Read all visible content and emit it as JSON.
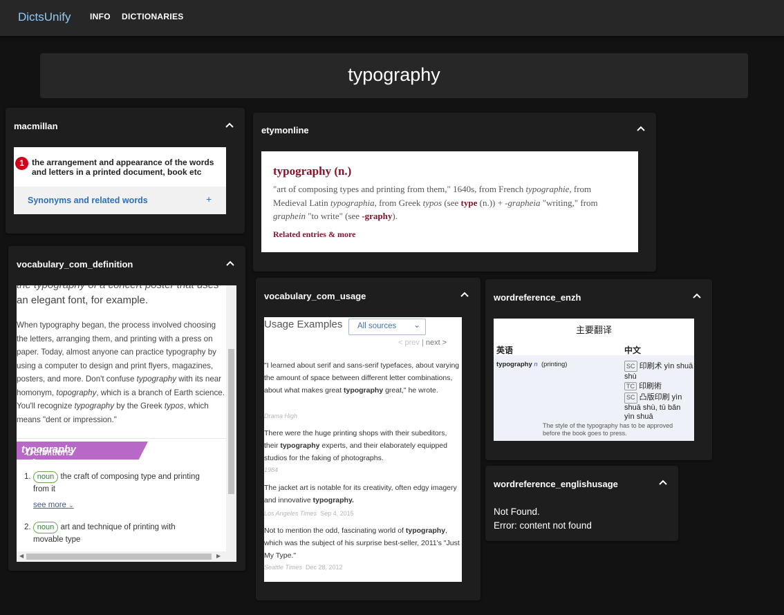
{
  "app": {
    "brand": "DictsUnify",
    "nav": [
      "INFO",
      "DICTIONARIES"
    ]
  },
  "search": {
    "query": "typography"
  },
  "cards": {
    "macmillan": {
      "title": "macmillan",
      "sense_number": "1",
      "definition": "the arrangement and appearance of the words and letters in a printed document, book etc",
      "synonyms_label": "Synonyms and related words",
      "synonyms_icon": "+"
    },
    "etymonline": {
      "title": "etymonline",
      "headword": "typography (n.)",
      "related": "Related entries & more"
    },
    "vocab_def": {
      "title": "vocabulary_com_definition",
      "cut_line": "the typography of a concert poster that uses",
      "intro": "an elegant font, for example.",
      "definitions_prefix": "Definitions of ",
      "definitions_word": "typography",
      "defs": [
        {
          "num": "1.",
          "pos": "noun",
          "text": "the craft of composing type and printing",
          "text2": "from it",
          "more": "see more"
        },
        {
          "num": "2.",
          "pos": "noun",
          "text": "art and technique of printing with",
          "text2": "movable type"
        }
      ]
    },
    "vocab_usage": {
      "title": "vocabulary_com_usage",
      "heading": "Usage Examples",
      "select_value": "All sources",
      "prev": "< prev",
      "sep": "|",
      "next": "next >",
      "examples": [
        {
          "source": "Drama High",
          "date": ""
        },
        {
          "source": "1984",
          "date": ""
        },
        {
          "source": "Los Angeles Times",
          "date": "Sep 4, 2015"
        },
        {
          "source": "Seattle Times",
          "date": "Dec 28, 2012"
        }
      ]
    },
    "wr_enzh": {
      "title": "wordreference_enzh",
      "table_title": "主要翻译",
      "col_en": "英语",
      "col_zh": "中文",
      "term": "typography",
      "pos": "n",
      "context": "(printing)",
      "translations": [
        {
          "tag": "SC",
          "text": "印刷术 yìn shuā",
          "text2": "shù"
        },
        {
          "tag": "TC",
          "text": "印刷術",
          "text2": ""
        },
        {
          "tag": "SC",
          "text": "凸版印刷 yìn",
          "text2": "shuā shù, tū bǎn",
          "text3": "yìn shuā"
        }
      ],
      "example": "The style of the typography has to be approved before the book goes to press."
    },
    "wr_usage": {
      "title": "wordreference_englishusage",
      "line1": "Not Found.",
      "line2": "Error: content not found"
    }
  }
}
